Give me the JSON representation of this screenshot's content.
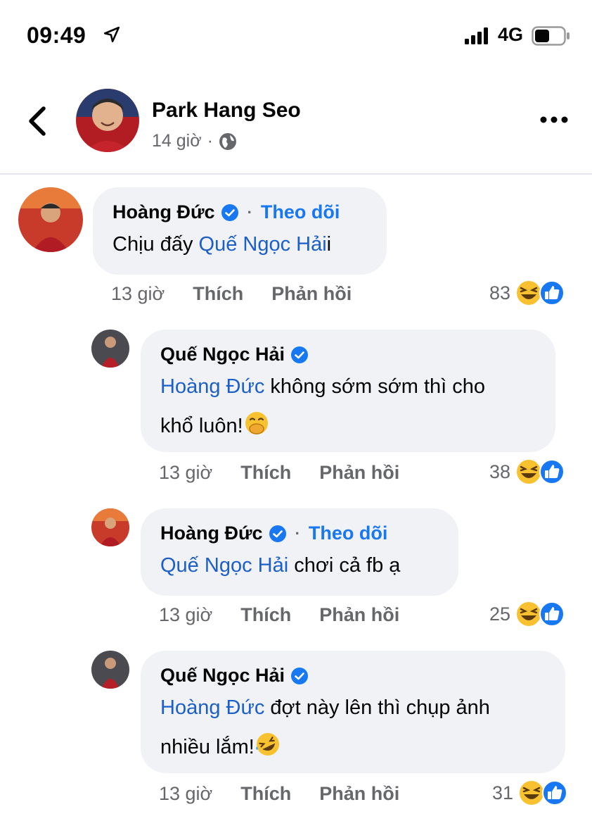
{
  "status_bar": {
    "time": "09:49",
    "network": "4G"
  },
  "post": {
    "author": "Park Hang Seo",
    "age": "14 giờ",
    "separator": "·"
  },
  "comments": [
    {
      "author": "Hoàng Đức",
      "verified": true,
      "follow_label": "Theo dõi",
      "mention": "Quế Ngọc Hải",
      "text_before": "Chịu đấy ",
      "text_after": "i",
      "age": "13 giờ",
      "like_label": "Thích",
      "reply_label": "Phản hồi",
      "reaction_count": "83"
    },
    {
      "author": "Quế Ngọc Hải",
      "verified": true,
      "mention": "Hoàng Đức",
      "text_line1": " không sớm sớm thì cho",
      "text_line2": "khổ luôn!",
      "emoji": "face-with-hand-over-mouth",
      "age": "13 giờ",
      "like_label": "Thích",
      "reply_label": "Phản hồi",
      "reaction_count": "38"
    },
    {
      "author": "Hoàng Đức",
      "verified": true,
      "follow_label": "Theo dõi",
      "mention": "Quế Ngọc Hải",
      "text_after": " chơi cả fb ạ",
      "age": "13 giờ",
      "like_label": "Thích",
      "reply_label": "Phản hồi",
      "reaction_count": "25"
    },
    {
      "author": "Quế Ngọc Hải",
      "verified": true,
      "mention": "Hoàng Đức",
      "text_line1": " đợt này lên thì chụp ảnh",
      "text_line2": "nhiều lắm!",
      "emoji": "rolling-on-the-floor-laughing",
      "age": "13 giờ",
      "like_label": "Thích",
      "reply_label": "Phản hồi",
      "reaction_count": "31"
    }
  ],
  "colors": {
    "mention": "#1c5fc9",
    "follow": "#1877f2",
    "bubble": "#f0f2f5",
    "secondary_text": "#65676b"
  }
}
